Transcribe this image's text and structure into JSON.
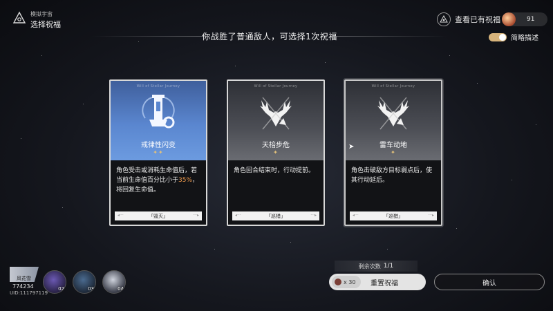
{
  "header": {
    "subtitle": "模拟宇宙",
    "title": "选择祝福"
  },
  "headline": "你战胜了普通敌人，可选择1次祝福",
  "top_right": {
    "view_blessings_label": "查看已有祝福",
    "currency_value": "91",
    "brief_toggle_label": "简略描述",
    "brief_toggle_on": true
  },
  "cards": [
    {
      "tiny": "Will of Stellar Journey",
      "name": "戒律性闪变",
      "stars": "✦✦",
      "desc_prefix": "角色受击或消耗生命值后，若当前生命值百分比小于",
      "desc_highlight": "35%",
      "desc_suffix": "，将回复生命值。",
      "path": "「毁灭」",
      "theme": "blue"
    },
    {
      "tiny": "Will of Stellar Journey",
      "name": "天棓步危",
      "stars": "✦",
      "desc": "角色回合结束时，行动提前。",
      "path": "「巡猎」",
      "theme": "gray"
    },
    {
      "tiny": "Will of Stellar Journey",
      "name": "雷车动地",
      "stars": "✦",
      "desc": "角色击破敌方目标弱点后，使其行动延后。",
      "path": "「巡猎」",
      "theme": "gray"
    }
  ],
  "bottom": {
    "remaining_label": "剩余次数",
    "remaining_value": "1/1",
    "reset_cost": "x 30",
    "reset_label": "重置祝福",
    "confirm_label": "确认"
  },
  "team": {
    "player_name": "风花雪",
    "player_level": "774234",
    "uid": "UID:111797119",
    "members": [
      "02",
      "03",
      "04"
    ]
  },
  "colors": {
    "accent_gold": "#e5c27a",
    "highlight_orange": "#ef9a4c",
    "card_blue": "#5a86cf"
  }
}
